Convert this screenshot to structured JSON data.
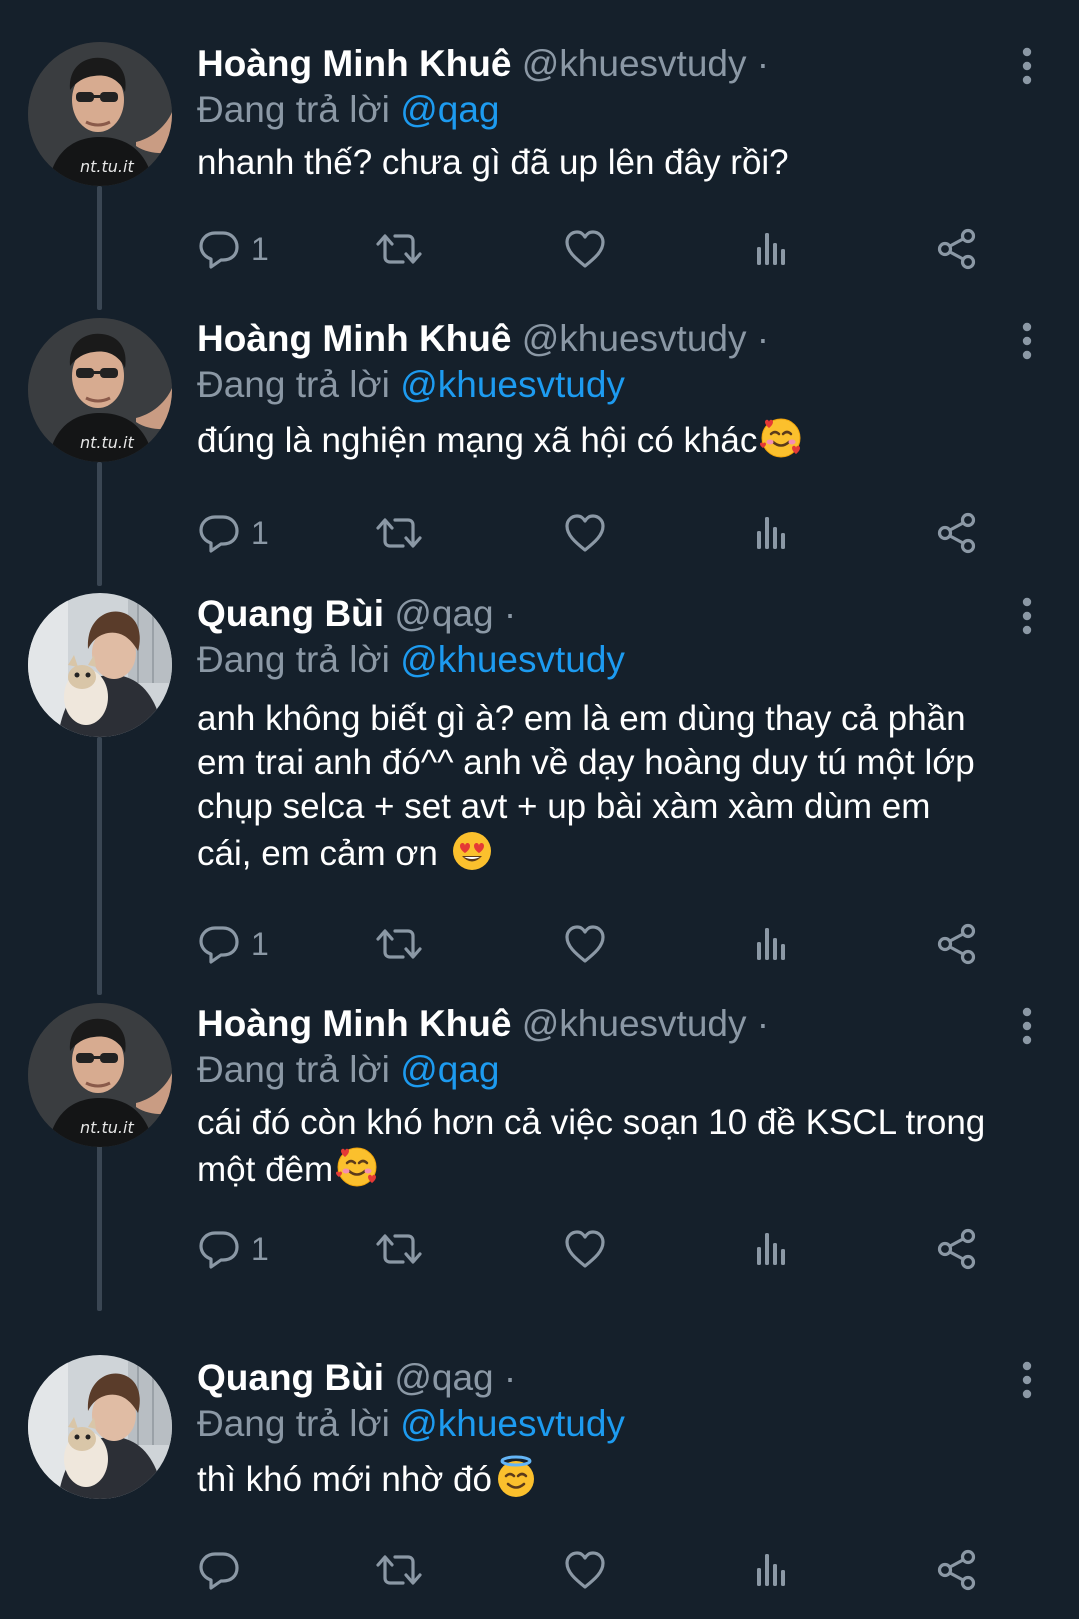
{
  "colors": {
    "background": "#15202b",
    "text": "#ffffff",
    "muted": "#8b98a5",
    "link": "#1d9bf0",
    "thread_line": "#3a4653"
  },
  "reply_prefix": "Đang trả lời",
  "tweets": [
    {
      "display_name": "Hoàng Minh Khuê",
      "handle": "@khuesvtudy",
      "dot": "·",
      "reply_to": "@qag",
      "text": "nhanh thế? chưa gì đã up lên đây rồi?",
      "emoji": "",
      "reply_count": "1",
      "avatar": "avatar-khue"
    },
    {
      "display_name": "Hoàng Minh Khuê",
      "handle": "@khuesvtudy",
      "dot": "·",
      "reply_to": "@khuesvtudy",
      "text": "đúng là nghiện mạng xã hội có khác",
      "emoji": "smiling-face-with-hearts",
      "reply_count": "1",
      "avatar": "avatar-khue"
    },
    {
      "display_name": "Quang Bùi",
      "handle": "@qag",
      "dot": "·",
      "reply_to": "@khuesvtudy",
      "text_lines": [
        "anh không biết gì à? em là em dùng thay cả phần",
        "em trai anh đó^^ anh về dạy hoàng duy tú một lớp",
        "chụp selca + set avt + up bài xàm xàm dùm em",
        "cái, em cảm ơn "
      ],
      "emoji": "heart-eyes",
      "reply_count": "1",
      "avatar": "avatar-quang"
    },
    {
      "display_name": "Hoàng Minh Khuê",
      "handle": "@khuesvtudy",
      "dot": "·",
      "reply_to": "@qag",
      "text_lines": [
        "cái đó còn khó hơn cả việc soạn 10 đề KSCL trong",
        "một đêm"
      ],
      "emoji": "smiling-face-with-hearts",
      "reply_count": "1",
      "avatar": "avatar-khue"
    },
    {
      "display_name": "Quang Bùi",
      "handle": "@qag",
      "dot": "·",
      "reply_to": "@khuesvtudy",
      "text": "thì khó mới nhờ đó",
      "emoji": "halo-face",
      "reply_count": "",
      "avatar": "avatar-quang"
    }
  ]
}
